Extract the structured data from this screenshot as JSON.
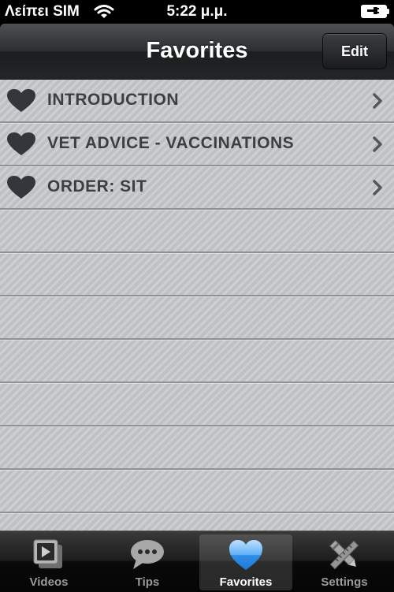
{
  "status_bar": {
    "carrier": "Λείπει SIM",
    "time": "5:22 μ.μ."
  },
  "nav": {
    "title": "Favorites",
    "edit_label": "Edit"
  },
  "favorites": [
    {
      "label": "INTRODUCTION"
    },
    {
      "label": "VET ADVICE - VACCINATIONS"
    },
    {
      "label": "ORDER: SIT"
    }
  ],
  "tabs": [
    {
      "label": "Videos",
      "icon": "video-icon",
      "active": false
    },
    {
      "label": "Tips",
      "icon": "speech-bubble-icon",
      "active": false
    },
    {
      "label": "Favorites",
      "icon": "heart-icon",
      "active": true
    },
    {
      "label": "Settings",
      "icon": "settings-tools-icon",
      "active": false
    }
  ],
  "colors": {
    "accent": "#3a9ef0",
    "heart": "#33363a",
    "list_text": "#3b3f44"
  }
}
